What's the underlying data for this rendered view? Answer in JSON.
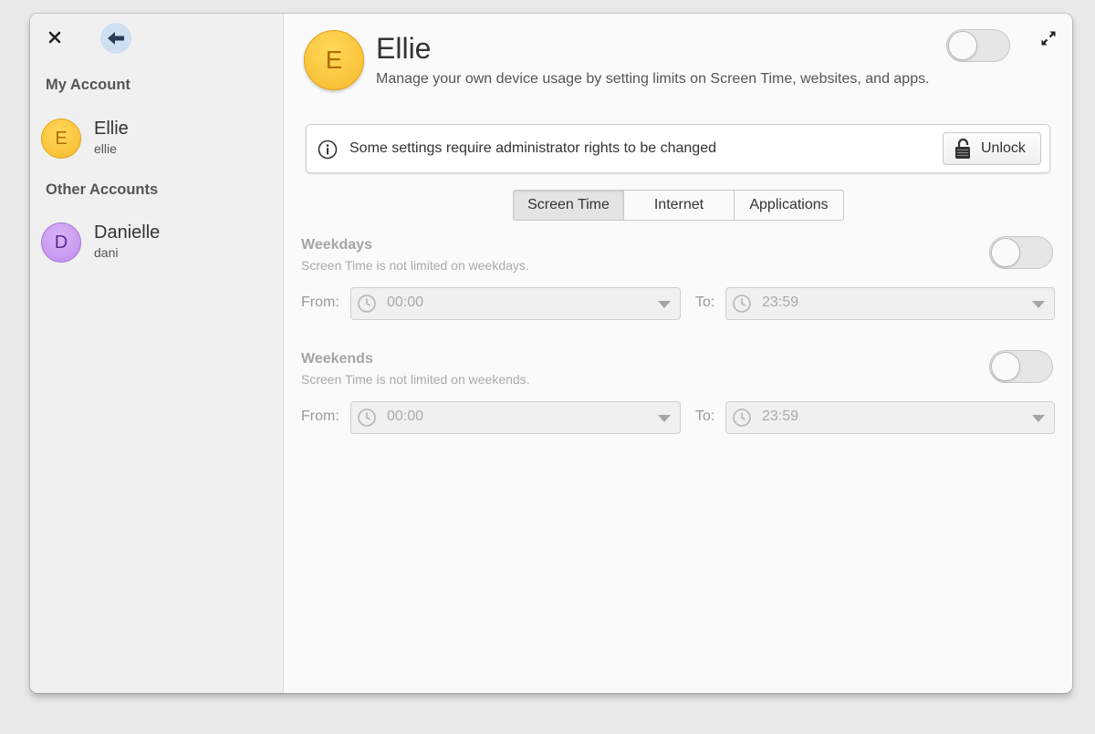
{
  "sidebar": {
    "my_account_header": "My Account",
    "other_accounts_header": "Other Accounts",
    "my_account": {
      "initial": "E",
      "name": "Ellie",
      "username": "ellie"
    },
    "other_accounts": [
      {
        "initial": "D",
        "name": "Danielle",
        "username": "dani"
      }
    ]
  },
  "header": {
    "initial": "E",
    "name": "Ellie",
    "description": "Manage your own device usage by setting limits on Screen Time, websites, and apps.",
    "enabled": false
  },
  "infobar": {
    "message": "Some settings require administrator rights to be changed",
    "unlock_label": "Unlock"
  },
  "tabs": [
    {
      "label": "Screen Time",
      "active": true
    },
    {
      "label": "Internet",
      "active": false
    },
    {
      "label": "Applications",
      "active": false
    }
  ],
  "screen_time": {
    "weekdays": {
      "title": "Weekdays",
      "description": "Screen Time is not limited on weekdays.",
      "enabled": false,
      "from_label": "From:",
      "from_value": "00:00",
      "to_label": "To:",
      "to_value": "23:59"
    },
    "weekends": {
      "title": "Weekends",
      "description": "Screen Time is not limited on weekends.",
      "enabled": false,
      "from_label": "From:",
      "from_value": "00:00",
      "to_label": "To:",
      "to_value": "23:59"
    }
  },
  "colors": {
    "accent": "#cfe0f3",
    "avatar_yellow": "#f6b92b",
    "avatar_purple": "#c08cec"
  }
}
